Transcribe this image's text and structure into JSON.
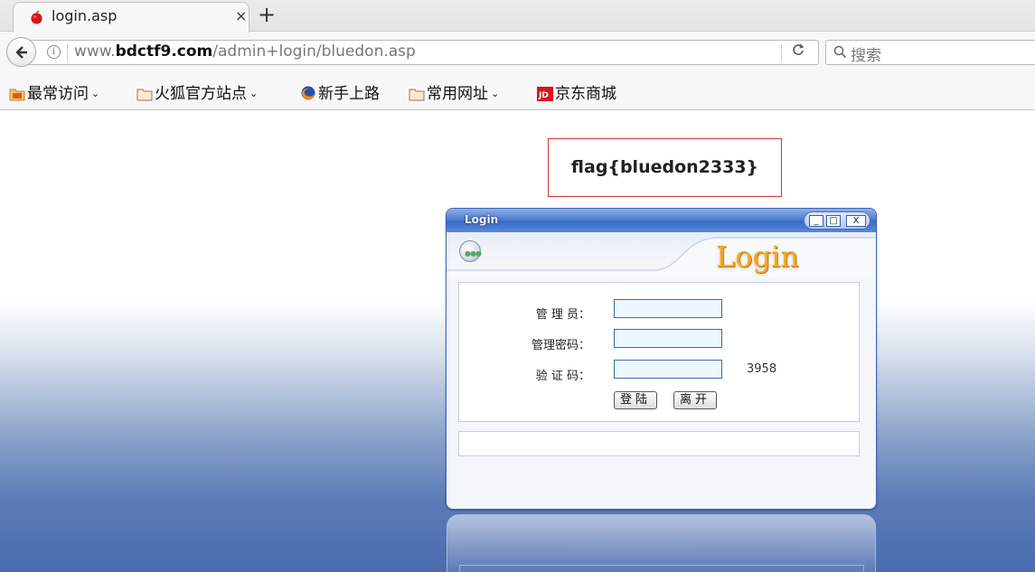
{
  "browser": {
    "tab": {
      "title": "login.asp",
      "close_glyph": "×"
    },
    "new_tab_glyph": "+",
    "url": {
      "prefix": "www.",
      "domain": "bdctf9.com",
      "path": "/admin+login/bluedon.asp"
    },
    "reload_glyph": "C",
    "search_placeholder": "搜索",
    "bookmarks": [
      {
        "label": "最常访问",
        "icon": "most-visited-folder-icon",
        "has_menu": true
      },
      {
        "label": "火狐官方站点",
        "icon": "folder-icon",
        "has_menu": true
      },
      {
        "label": "新手上路",
        "icon": "firefox-icon",
        "has_menu": false
      },
      {
        "label": "常用网址",
        "icon": "folder-icon",
        "has_menu": true
      },
      {
        "label": "京东商城",
        "icon": "jd-icon",
        "has_menu": false
      }
    ],
    "chevron_glyph": "❯"
  },
  "page": {
    "flag": "flag{bluedon2333}",
    "login_window": {
      "title": "Login",
      "brand": "Login",
      "controls": {
        "minimize": "_",
        "maximize": "□",
        "close": "X"
      },
      "fields": [
        {
          "label": "管 理 员：",
          "value": ""
        },
        {
          "label": "管理密码：",
          "value": ""
        },
        {
          "label": "验 证 码：",
          "value": ""
        }
      ],
      "captcha": "3958",
      "buttons": {
        "login": "登陆",
        "leave": "离开"
      },
      "status": ""
    }
  }
}
